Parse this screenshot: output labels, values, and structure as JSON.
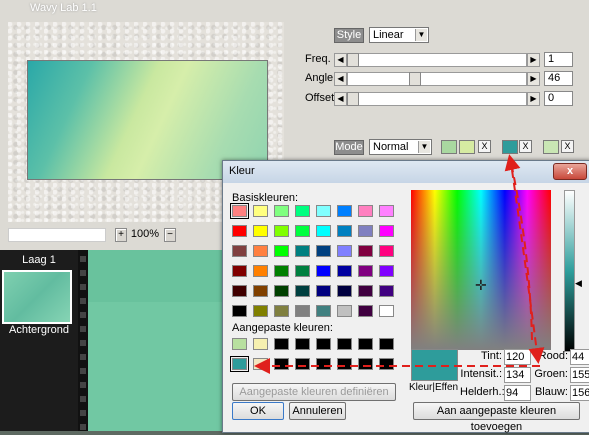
{
  "plugin": {
    "title": "Wavy Lab 1.1",
    "style": {
      "button": "Style",
      "value": "Linear"
    },
    "sliders": [
      {
        "label": "Freq.",
        "value": "1",
        "level": 0.0
      },
      {
        "label": "Angle",
        "value": "46",
        "level": 0.35
      },
      {
        "label": "Offset",
        "value": "0",
        "level": 0.0
      }
    ],
    "mode": {
      "button": "Mode",
      "value": "Normal"
    },
    "zoom": {
      "plus": "+",
      "value": "100%",
      "minus": "−"
    },
    "swatches": [
      {
        "color": "#a9d8a0",
        "close": "X"
      },
      {
        "color": "#d6eba2",
        "close": "X"
      },
      {
        "color": "#2e9c9b",
        "close": "X"
      },
      {
        "color": "#c9e6b4",
        "close": "X"
      }
    ]
  },
  "layers": {
    "items": [
      {
        "label": "Laag 1"
      },
      {
        "label": "Achtergrond"
      }
    ]
  },
  "color_dialog": {
    "title": "Kleur",
    "close": "x",
    "basic_label": "Basiskleuren:",
    "basic_colors": [
      "#ff8080",
      "#ffff80",
      "#80ff80",
      "#00ff80",
      "#80ffff",
      "#0080ff",
      "#ff80c0",
      "#ff80ff",
      "#ff0000",
      "#ffff00",
      "#80ff00",
      "#00ff40",
      "#00ffff",
      "#0080c0",
      "#8080c0",
      "#ff00ff",
      "#804040",
      "#ff8040",
      "#00ff00",
      "#008080",
      "#004080",
      "#8080ff",
      "#800040",
      "#ff0080",
      "#800000",
      "#ff8000",
      "#008000",
      "#008040",
      "#0000ff",
      "#0000a0",
      "#800080",
      "#8000ff",
      "#400000",
      "#804000",
      "#004000",
      "#004040",
      "#000080",
      "#000040",
      "#400040",
      "#400080",
      "#000000",
      "#808000",
      "#808040",
      "#808080",
      "#408080",
      "#c0c0c0",
      "#400040",
      "#ffffff"
    ],
    "custom_label": "Aangepaste kleuren:",
    "custom_colors": [
      "#b8e0a0",
      "#f6f0b0",
      "#000000",
      "#000000",
      "#000000",
      "#000000",
      "#000000",
      "#000000",
      "#2e9c9b",
      "#f2e6c0",
      "#000000",
      "#000000",
      "#000000",
      "#000000",
      "#000000",
      "#000000"
    ],
    "define_custom": "Aangepaste kleuren definiëren >>",
    "ok": "OK",
    "cancel": "Annuleren",
    "add_custom": "Aan aangepaste kleuren toevoegen",
    "solid_label": "Kleur|Effen",
    "current_color": "#2e9c9b",
    "fields": [
      {
        "label": "Tint:",
        "value": "120"
      },
      {
        "label": "Rood:",
        "value": "44"
      },
      {
        "label": "Intensit.:",
        "value": "134"
      },
      {
        "label": "Groen:",
        "value": "155"
      },
      {
        "label": "Helderh.:",
        "value": "94"
      },
      {
        "label": "Blauw:",
        "value": "156"
      }
    ]
  },
  "annotation_color": "#e0201c"
}
